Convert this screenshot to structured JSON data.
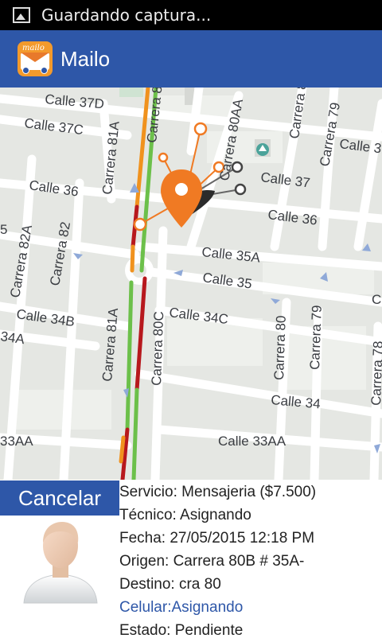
{
  "status_bar": {
    "notification_text": "Guardando captura..."
  },
  "app_bar": {
    "logo_text": "mailo",
    "title": "Mailo"
  },
  "map": {
    "street_labels": {
      "calle_37d": "Calle 37D",
      "calle_37c": "Calle 37C",
      "calle_37": "Calle 37",
      "calle_36_left": "Calle 36",
      "calle_36_right": "Calle 36",
      "calle_35a": "Calle 35A",
      "calle_35": "Calle 35",
      "calle_34b": "Calle 34B",
      "calle_34c": "Calle 34C",
      "calle_34": "Calle 34",
      "calle_33aa_left": "33AA",
      "calle_33aa": "Calle 33AA",
      "calle_34a": "34A",
      "calle_3_right": "Calle 3",
      "c_right": "C",
      "num_5": "5",
      "carrera_81a_top": "Carrera 81A",
      "carrera_81": "Carrera 81",
      "carrera_80aa": "Carrera 80AA",
      "carrera_8": "Carrera 8",
      "carrera_79_top": "Carrera 79",
      "carrera_82a": "Carrera 82A",
      "carrera_82": "Carrera 82",
      "carrera_81a_bottom": "Carrera 81A",
      "carrera_80c": "Carrera 80C",
      "carrera_80": "Carrera 80",
      "carrera_79_bottom": "Carrera 79",
      "carrera_78": "Carrera 78"
    },
    "pin_color": "#f07a23",
    "cluster_marker_color": "#222222"
  },
  "actions": {
    "cancel_label": "Cancelar"
  },
  "details": {
    "servicio": "Servicio: Mensajeria ($7.500)",
    "tecnico": "Técnico: Asignando",
    "fecha": "Fecha: 27/05/2015 12:18 PM",
    "origen": "Origen: Carrera 80B # 35A-",
    "destino": "Destino: cra 80",
    "celular": "Celular:Asignando",
    "estado": "Estado: Pendiente"
  },
  "colors": {
    "app_bar": "#2e57a8",
    "link": "#2e57a8",
    "traffic_green": "#6cc04a",
    "traffic_orange": "#f0921e",
    "traffic_red": "#b7181d"
  }
}
